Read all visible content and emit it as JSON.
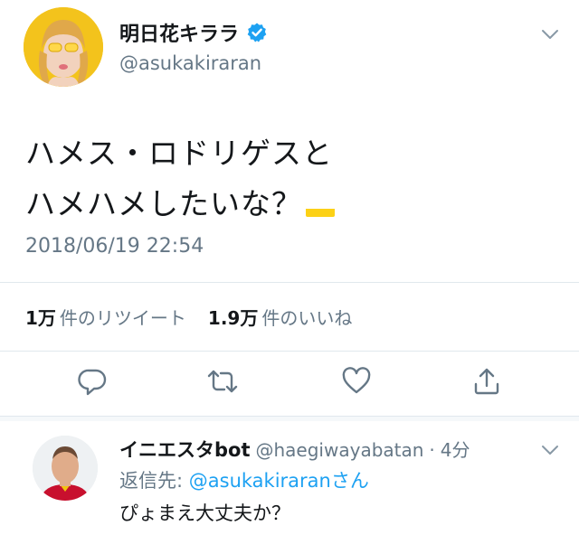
{
  "tweet": {
    "display_name": "明日花キララ",
    "handle": "@asukakiraran",
    "text_line1": "ハメス・ロドリゲスと",
    "text_line2": "ハメハメしたいな？",
    "timestamp": "2018/06/19 22:54",
    "retweets_count": "1万",
    "retweets_label": "件のリツイート",
    "likes_count": "1.9万",
    "likes_label": "件のいいね"
  },
  "reply": {
    "display_name": "イニエスタbot",
    "handle": "@haegiwayabatan",
    "separator": "·",
    "time": "4分",
    "reply_to_prefix": "返信先:",
    "reply_to_handle": "@asukakiraran",
    "reply_to_suffix": "さん",
    "text": "ぴょまえ大丈夫か？"
  },
  "icons": {
    "verified": "verified-badge-icon",
    "caret": "chevron-down-icon",
    "reply": "reply-icon",
    "retweet": "retweet-icon",
    "like": "heart-icon",
    "share": "share-icon",
    "flag": "colombia-flag-icon"
  },
  "colors": {
    "accent": "#1da1f2",
    "secondary_text": "#657786",
    "primary_text": "#14171a",
    "divider": "#e1e8ed"
  }
}
